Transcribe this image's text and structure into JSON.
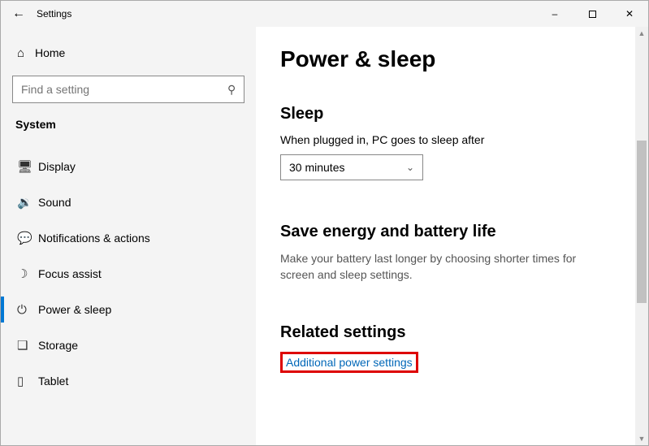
{
  "titlebar": {
    "title": "Settings"
  },
  "sidebar": {
    "home_label": "Home",
    "search_placeholder": "Find a setting",
    "category": "System",
    "items": [
      {
        "label": "Display"
      },
      {
        "label": "Sound"
      },
      {
        "label": "Notifications & actions"
      },
      {
        "label": "Focus assist"
      },
      {
        "label": "Power & sleep"
      },
      {
        "label": "Storage"
      },
      {
        "label": "Tablet"
      }
    ]
  },
  "main": {
    "page_title": "Power & sleep",
    "sleep": {
      "heading": "Sleep",
      "field_label": "When plugged in, PC goes to sleep after",
      "selected": "30 minutes"
    },
    "energy": {
      "heading": "Save energy and battery life",
      "description": "Make your battery last longer by choosing shorter times for screen and sleep settings."
    },
    "related": {
      "heading": "Related settings",
      "link": "Additional power settings"
    }
  }
}
